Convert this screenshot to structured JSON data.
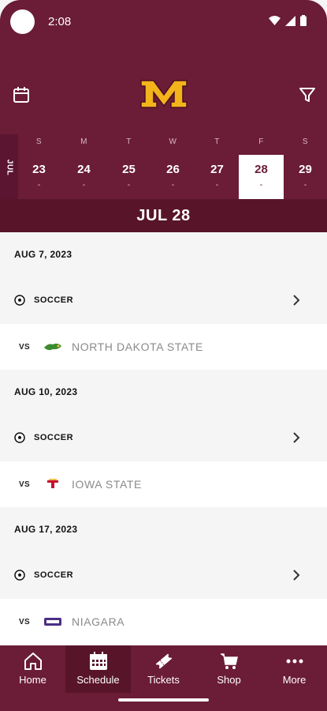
{
  "status_bar": {
    "time": "2:08"
  },
  "header": {
    "calendar_icon": "calendar-icon",
    "logo_icon": "minnesota-m-logo",
    "filter_icon": "filter-icon"
  },
  "week": {
    "month": "JUL",
    "days": [
      {
        "dow": "S",
        "num": "23",
        "dash": "-"
      },
      {
        "dow": "M",
        "num": "24",
        "dash": "-"
      },
      {
        "dow": "T",
        "num": "25",
        "dash": "-"
      },
      {
        "dow": "W",
        "num": "26",
        "dash": "-"
      },
      {
        "dow": "T",
        "num": "27",
        "dash": "-"
      },
      {
        "dow": "F",
        "num": "28",
        "dash": "-"
      },
      {
        "dow": "S",
        "num": "29",
        "dash": "-"
      }
    ],
    "selected_index": 5
  },
  "selected_date": "JUL 28",
  "events": [
    {
      "date": "AUG 7, 2023",
      "sport": "SOCCER",
      "vs": "VS",
      "opponent": "NORTH DAKOTA STATE"
    },
    {
      "date": "AUG 10, 2023",
      "sport": "SOCCER",
      "vs": "VS",
      "opponent": "IOWA STATE"
    },
    {
      "date": "AUG 17, 2023",
      "sport": "SOCCER",
      "vs": "VS",
      "opponent": "NIAGARA"
    }
  ],
  "nav": [
    {
      "label": "Home",
      "icon": "home-icon"
    },
    {
      "label": "Schedule",
      "icon": "calendar-grid-icon"
    },
    {
      "label": "Tickets",
      "icon": "ticket-icon"
    },
    {
      "label": "Shop",
      "icon": "cart-icon"
    },
    {
      "label": "More",
      "icon": "more-dots-icon"
    }
  ],
  "colors": {
    "maroon": "#6b1c37",
    "gold": "#f2b31b",
    "dark_maroon": "#581529"
  }
}
